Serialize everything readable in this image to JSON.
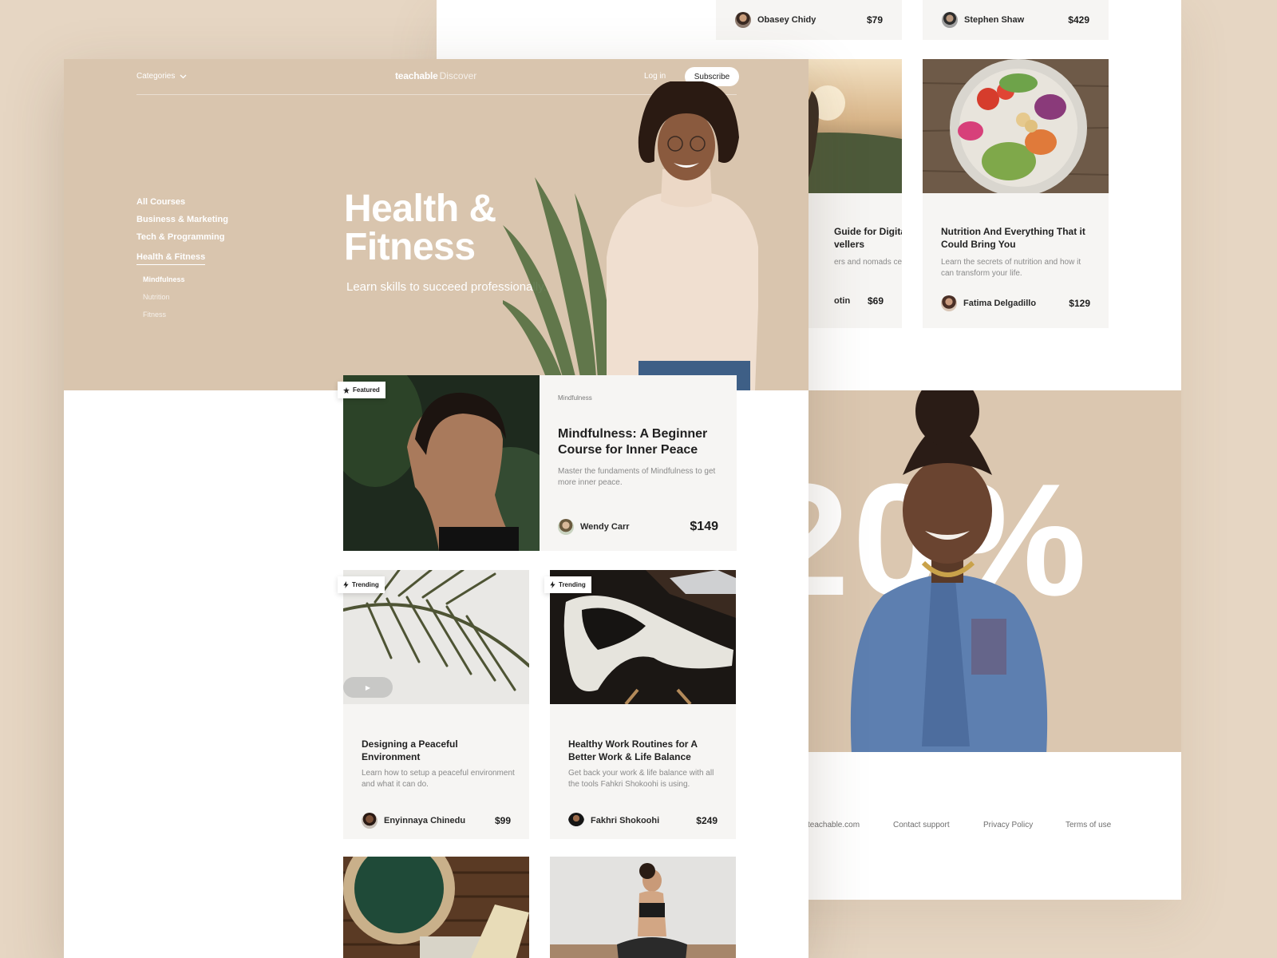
{
  "brand": {
    "name": "teachable",
    "suffix": "Discover"
  },
  "nav": {
    "categories_label": "Categories",
    "login_label": "Log in",
    "subscribe_label": "Subscribe"
  },
  "sidebar": {
    "items": [
      "All Courses",
      "Business & Marketing",
      "Tech & Programming",
      "Health & Fitness"
    ],
    "active_item": "Health & Fitness",
    "subitems": [
      "Mindfulness",
      "Nutrition",
      "Fitness"
    ],
    "active_subitem": "Mindfulness"
  },
  "hero": {
    "title_line1": "Health &",
    "title_line2": "Fitness",
    "subtitle": "Learn skills to succeed professionally."
  },
  "featured": {
    "badge": "Featured",
    "category": "Mindfulness",
    "title": "Mindfulness: A Beginner Course for Inner Peace",
    "description": "Master the fundaments of Mindfulness to get more inner peace.",
    "instructor": "Wendy Carr",
    "price": "$149"
  },
  "courses": [
    {
      "badge": "Trending",
      "title": "Designing a Peaceful Environment",
      "description": "Learn how to setup a peaceful environment and what it can do.",
      "instructor": "Enyinnaya Chinedu",
      "price": "$99"
    },
    {
      "badge": "Trending",
      "title": "Healthy Work Routines for A Better Work & Life Balance",
      "description": "Get back your work & life balance with all the tools Fahkri Shokoohi is using.",
      "instructor": "Fakhri Shokoohi",
      "price": "$249"
    }
  ],
  "back_page": {
    "top_strips": [
      {
        "instructor": "Obasey Chidy",
        "price": "$79"
      },
      {
        "instructor": "Stephen Shaw",
        "price": "$429"
      }
    ],
    "cards": [
      {
        "title": "Guide for Digital vellers",
        "description": "ers and nomads ce.",
        "instructor": "otin",
        "price": "$69"
      },
      {
        "title": "Nutrition And Everything That it Could Bring You",
        "description": "Learn the secrets of nutrition and how it can transform your life.",
        "instructor": "Fatima Delgadillo",
        "price": "$129"
      }
    ],
    "promo_number": "20%",
    "footer_links": [
      "teachable.com",
      "Contact support",
      "Privacy Policy",
      "Terms of use"
    ]
  },
  "icons": {
    "categories_chevron": "chevron-down-icon",
    "featured_badge": "star-icon",
    "trending_badge": "lightning-icon",
    "play": "play-icon"
  },
  "colors": {
    "background": "#e6d6c3",
    "hero": "#d9c5ae",
    "card": "#f6f5f3",
    "promo": "#dbc7b0"
  }
}
